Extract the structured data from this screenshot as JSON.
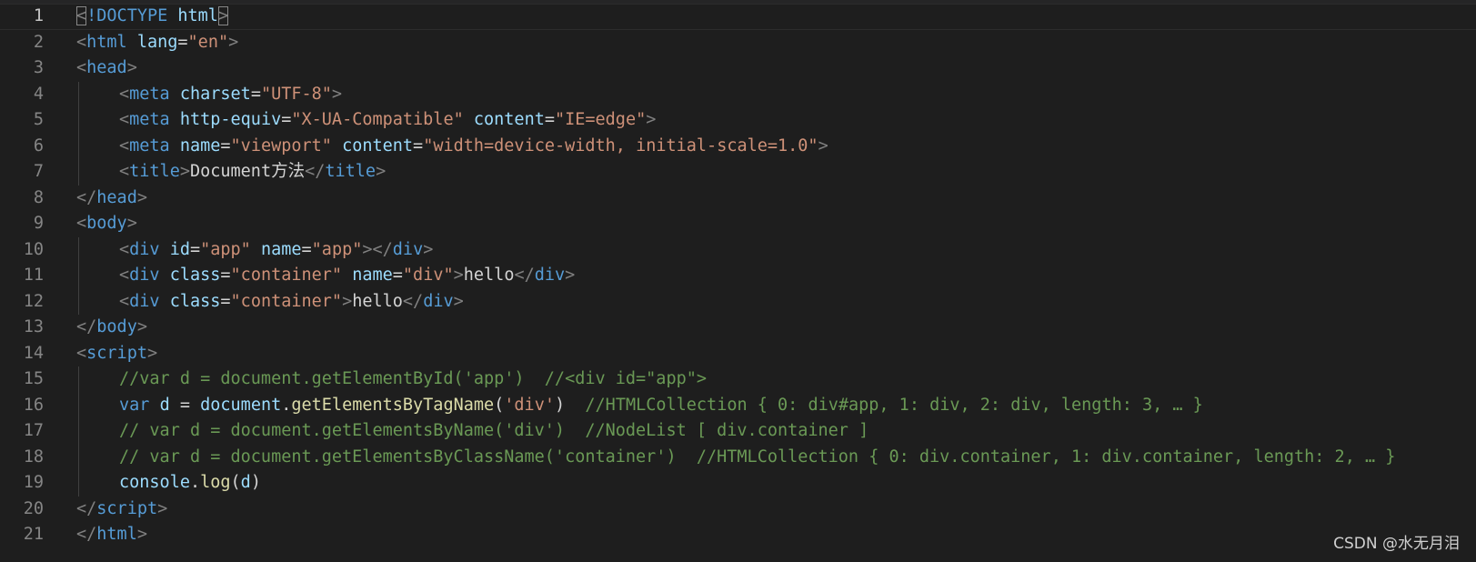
{
  "editor": {
    "current_line": 1,
    "lines": [
      {
        "number": "1",
        "tokens": [
          {
            "t": "<",
            "k": "punct"
          },
          {
            "t": "!DOCTYPE",
            "k": "tag"
          },
          {
            "t": " ",
            "k": "plain"
          },
          {
            "t": "html",
            "k": "attr"
          },
          {
            "t": ">",
            "k": "punct"
          }
        ]
      },
      {
        "number": "2",
        "tokens": [
          {
            "t": "<",
            "k": "punct"
          },
          {
            "t": "html",
            "k": "tag"
          },
          {
            "t": " ",
            "k": "plain"
          },
          {
            "t": "lang",
            "k": "attr"
          },
          {
            "t": "=",
            "k": "plain"
          },
          {
            "t": "\"en\"",
            "k": "str"
          },
          {
            "t": ">",
            "k": "punct"
          }
        ]
      },
      {
        "number": "3",
        "tokens": [
          {
            "t": "<",
            "k": "punct"
          },
          {
            "t": "head",
            "k": "tag"
          },
          {
            "t": ">",
            "k": "punct"
          }
        ]
      },
      {
        "number": "4",
        "indent": 1,
        "tokens": [
          {
            "t": "<",
            "k": "punct"
          },
          {
            "t": "meta",
            "k": "tag"
          },
          {
            "t": " ",
            "k": "plain"
          },
          {
            "t": "charset",
            "k": "attr"
          },
          {
            "t": "=",
            "k": "plain"
          },
          {
            "t": "\"UTF-8\"",
            "k": "str"
          },
          {
            "t": ">",
            "k": "punct"
          }
        ]
      },
      {
        "number": "5",
        "indent": 1,
        "tokens": [
          {
            "t": "<",
            "k": "punct"
          },
          {
            "t": "meta",
            "k": "tag"
          },
          {
            "t": " ",
            "k": "plain"
          },
          {
            "t": "http-equiv",
            "k": "attr"
          },
          {
            "t": "=",
            "k": "plain"
          },
          {
            "t": "\"X-UA-Compatible\"",
            "k": "str"
          },
          {
            "t": " ",
            "k": "plain"
          },
          {
            "t": "content",
            "k": "attr"
          },
          {
            "t": "=",
            "k": "plain"
          },
          {
            "t": "\"IE=edge\"",
            "k": "str"
          },
          {
            "t": ">",
            "k": "punct"
          }
        ]
      },
      {
        "number": "6",
        "indent": 1,
        "tokens": [
          {
            "t": "<",
            "k": "punct"
          },
          {
            "t": "meta",
            "k": "tag"
          },
          {
            "t": " ",
            "k": "plain"
          },
          {
            "t": "name",
            "k": "attr"
          },
          {
            "t": "=",
            "k": "plain"
          },
          {
            "t": "\"viewport\"",
            "k": "str"
          },
          {
            "t": " ",
            "k": "plain"
          },
          {
            "t": "content",
            "k": "attr"
          },
          {
            "t": "=",
            "k": "plain"
          },
          {
            "t": "\"width=device-width, initial-scale=1.0\"",
            "k": "str"
          },
          {
            "t": ">",
            "k": "punct"
          }
        ]
      },
      {
        "number": "7",
        "indent": 1,
        "tokens": [
          {
            "t": "<",
            "k": "punct"
          },
          {
            "t": "title",
            "k": "tag"
          },
          {
            "t": ">",
            "k": "punct"
          },
          {
            "t": "Document方法",
            "k": "text"
          },
          {
            "t": "</",
            "k": "punct"
          },
          {
            "t": "title",
            "k": "tag"
          },
          {
            "t": ">",
            "k": "punct"
          }
        ]
      },
      {
        "number": "8",
        "tokens": [
          {
            "t": "</",
            "k": "punct"
          },
          {
            "t": "head",
            "k": "tag"
          },
          {
            "t": ">",
            "k": "punct"
          }
        ]
      },
      {
        "number": "9",
        "tokens": [
          {
            "t": "<",
            "k": "punct"
          },
          {
            "t": "body",
            "k": "tag"
          },
          {
            "t": ">",
            "k": "punct"
          }
        ]
      },
      {
        "number": "10",
        "indent": 1,
        "tokens": [
          {
            "t": "<",
            "k": "punct"
          },
          {
            "t": "div",
            "k": "tag"
          },
          {
            "t": " ",
            "k": "plain"
          },
          {
            "t": "id",
            "k": "attr"
          },
          {
            "t": "=",
            "k": "plain"
          },
          {
            "t": "\"app\"",
            "k": "str"
          },
          {
            "t": " ",
            "k": "plain"
          },
          {
            "t": "name",
            "k": "attr"
          },
          {
            "t": "=",
            "k": "plain"
          },
          {
            "t": "\"app\"",
            "k": "str"
          },
          {
            "t": "></",
            "k": "punct"
          },
          {
            "t": "div",
            "k": "tag"
          },
          {
            "t": ">",
            "k": "punct"
          }
        ]
      },
      {
        "number": "11",
        "indent": 1,
        "tokens": [
          {
            "t": "<",
            "k": "punct"
          },
          {
            "t": "div",
            "k": "tag"
          },
          {
            "t": " ",
            "k": "plain"
          },
          {
            "t": "class",
            "k": "attr"
          },
          {
            "t": "=",
            "k": "plain"
          },
          {
            "t": "\"container\"",
            "k": "str"
          },
          {
            "t": " ",
            "k": "plain"
          },
          {
            "t": "name",
            "k": "attr"
          },
          {
            "t": "=",
            "k": "plain"
          },
          {
            "t": "\"div\"",
            "k": "str"
          },
          {
            "t": ">",
            "k": "punct"
          },
          {
            "t": "hello",
            "k": "text"
          },
          {
            "t": "</",
            "k": "punct"
          },
          {
            "t": "div",
            "k": "tag"
          },
          {
            "t": ">",
            "k": "punct"
          }
        ]
      },
      {
        "number": "12",
        "indent": 1,
        "tokens": [
          {
            "t": "<",
            "k": "punct"
          },
          {
            "t": "div",
            "k": "tag"
          },
          {
            "t": " ",
            "k": "plain"
          },
          {
            "t": "class",
            "k": "attr"
          },
          {
            "t": "=",
            "k": "plain"
          },
          {
            "t": "\"container\"",
            "k": "str"
          },
          {
            "t": ">",
            "k": "punct"
          },
          {
            "t": "hello",
            "k": "text"
          },
          {
            "t": "</",
            "k": "punct"
          },
          {
            "t": "div",
            "k": "tag"
          },
          {
            "t": ">",
            "k": "punct"
          }
        ]
      },
      {
        "number": "13",
        "tokens": [
          {
            "t": "</",
            "k": "punct"
          },
          {
            "t": "body",
            "k": "tag"
          },
          {
            "t": ">",
            "k": "punct"
          }
        ]
      },
      {
        "number": "14",
        "tokens": [
          {
            "t": "<",
            "k": "punct"
          },
          {
            "t": "script",
            "k": "tag"
          },
          {
            "t": ">",
            "k": "punct"
          }
        ]
      },
      {
        "number": "15",
        "indent": 1,
        "tokens": [
          {
            "t": "//var d = document.getElementById('app')  //<div id=\"app\">",
            "k": "comment"
          }
        ]
      },
      {
        "number": "16",
        "indent": 1,
        "tokens": [
          {
            "t": "var",
            "k": "kw"
          },
          {
            "t": " ",
            "k": "plain"
          },
          {
            "t": "d",
            "k": "var"
          },
          {
            "t": " = ",
            "k": "plain"
          },
          {
            "t": "document",
            "k": "var"
          },
          {
            "t": ".",
            "k": "plain"
          },
          {
            "t": "getElementsByTagName",
            "k": "fn"
          },
          {
            "t": "(",
            "k": "plain"
          },
          {
            "t": "'div'",
            "k": "str"
          },
          {
            "t": ")  ",
            "k": "plain"
          },
          {
            "t": "//HTMLCollection { 0: div#app, 1: div, 2: div, length: 3, … }",
            "k": "comment"
          }
        ]
      },
      {
        "number": "17",
        "indent": 1,
        "tokens": [
          {
            "t": "// var d = document.getElementsByName('div')  //NodeList [ div.container ]",
            "k": "comment"
          }
        ]
      },
      {
        "number": "18",
        "indent": 1,
        "tokens": [
          {
            "t": "// var d = document.getElementsByClassName('container')  //HTMLCollection { 0: div.container, 1: div.container, length: 2, … }",
            "k": "comment"
          }
        ]
      },
      {
        "number": "19",
        "indent": 1,
        "tokens": [
          {
            "t": "console",
            "k": "var"
          },
          {
            "t": ".",
            "k": "plain"
          },
          {
            "t": "log",
            "k": "fn"
          },
          {
            "t": "(",
            "k": "plain"
          },
          {
            "t": "d",
            "k": "var"
          },
          {
            "t": ")",
            "k": "plain"
          }
        ]
      },
      {
        "number": "20",
        "tokens": [
          {
            "t": "</",
            "k": "punct"
          },
          {
            "t": "script",
            "k": "tag"
          },
          {
            "t": ">",
            "k": "punct"
          }
        ]
      },
      {
        "number": "21",
        "tokens": [
          {
            "t": "</",
            "k": "punct"
          },
          {
            "t": "html",
            "k": "tag"
          },
          {
            "t": ">",
            "k": "punct"
          }
        ]
      }
    ]
  },
  "watermark": "CSDN @水无月泪",
  "colors": {
    "background": "#1e1e1e",
    "tag": "#569cd6",
    "attribute": "#9cdcfe",
    "string": "#ce9178",
    "comment": "#6a9955",
    "function": "#dcdcaa"
  }
}
